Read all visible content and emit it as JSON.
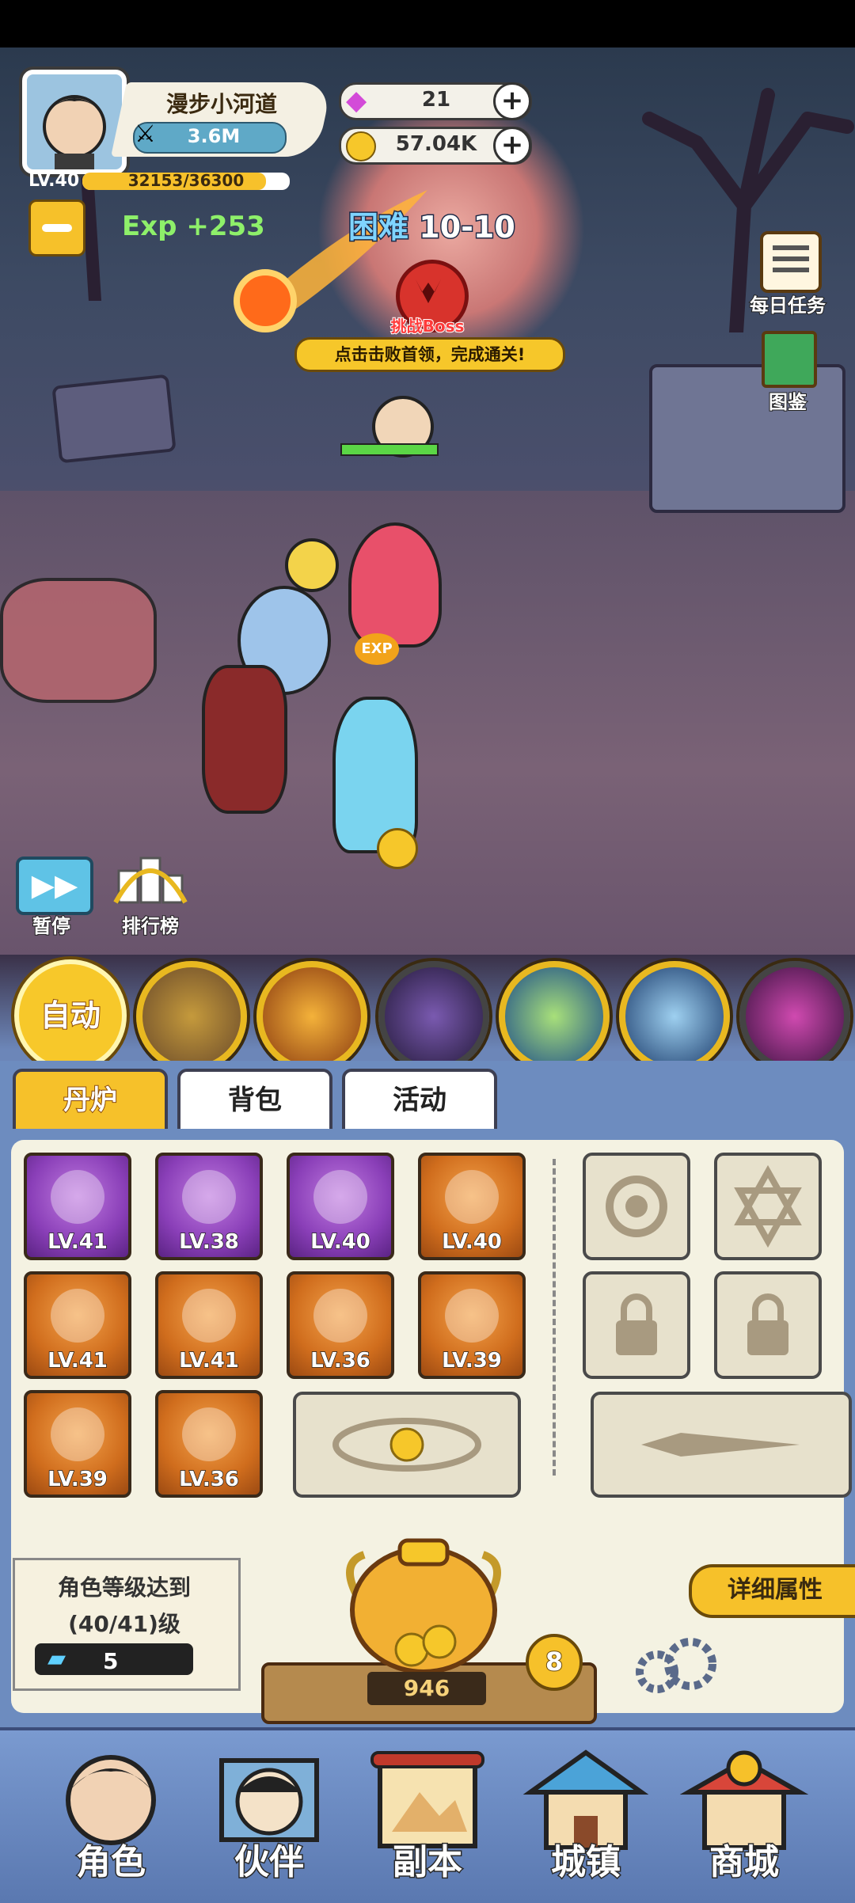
{
  "player": {
    "name": "漫步小河道",
    "power": "3.6M",
    "level": "LV.40",
    "exp_progress": "32153/36300",
    "exp_fraction": 0.886,
    "exp_gain": "Exp +253"
  },
  "currency": {
    "gems": "21",
    "coins": "57.04K"
  },
  "stage": {
    "difficulty_label": "困难",
    "stage_number": "10-10",
    "boss_challenge": "挑战Boss",
    "boss_hint": "点击击败首领，完成通关!"
  },
  "side_menu": {
    "daily_tasks": "每日任务",
    "codex": "图鉴"
  },
  "controls": {
    "pause": "暂停",
    "ranking": "排行榜",
    "auto": "自动"
  },
  "tabs": [
    {
      "label": "丹炉",
      "active": true
    },
    {
      "label": "背包",
      "active": false
    },
    {
      "label": "活动",
      "active": false
    }
  ],
  "equipment": [
    {
      "level": "LV.41",
      "rarity": "purple",
      "icon": "sword-icon"
    },
    {
      "level": "LV.38",
      "rarity": "purple",
      "icon": "helmet-icon"
    },
    {
      "level": "LV.40",
      "rarity": "purple",
      "icon": "armor-icon"
    },
    {
      "level": "LV.40",
      "rarity": "orange",
      "icon": "crane-orb-icon"
    },
    {
      "level": "LV.41",
      "rarity": "orange",
      "icon": "fan-icon"
    },
    {
      "level": "LV.41",
      "rarity": "orange",
      "icon": "shield-icon"
    },
    {
      "level": "LV.36",
      "rarity": "orange",
      "icon": "pouch-icon"
    },
    {
      "level": "LV.39",
      "rarity": "orange",
      "icon": "gourd-icon"
    },
    {
      "level": "LV.39",
      "rarity": "orange",
      "icon": "bracelet-icon"
    },
    {
      "level": "LV.36",
      "rarity": "orange",
      "icon": "boots-icon"
    }
  ],
  "furnace": {
    "requirement_line1": "角色等级达到",
    "requirement_line2": "(40/41)级",
    "tickets": "5",
    "coin_count": "946",
    "furnace_level": "8",
    "details_button": "详细属性"
  },
  "nav": [
    {
      "label": "角色",
      "icon": "character-icon"
    },
    {
      "label": "伙伴",
      "icon": "partner-icon"
    },
    {
      "label": "副本",
      "icon": "dungeon-scroll-icon"
    },
    {
      "label": "城镇",
      "icon": "town-icon"
    },
    {
      "label": "商城",
      "icon": "shop-icon"
    }
  ],
  "colors": {
    "gold": "#e8b820",
    "purple_rarity": "#8a3fb8",
    "orange_rarity": "#d06d1d",
    "exp_green": "#8ef06a",
    "panel_blue": "#6d8cbf"
  }
}
